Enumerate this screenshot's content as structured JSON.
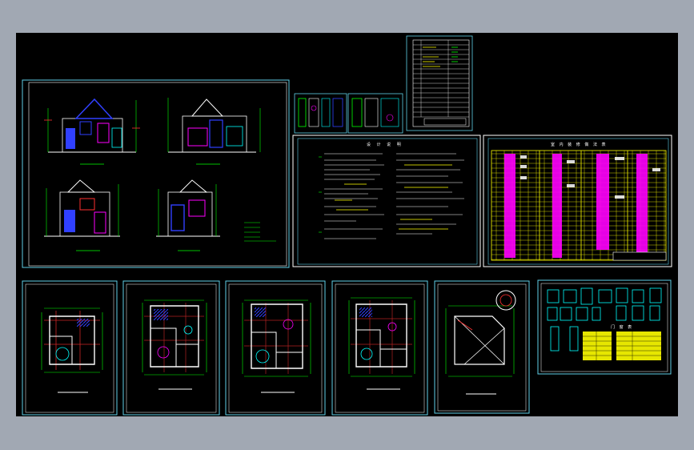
{
  "app": {
    "viewport_background": "#a1a8b3",
    "model_space_background": "#000000"
  },
  "sheets": {
    "elevations": {
      "name": "elevation-sheet"
    },
    "detail_small_a": {
      "name": "detail-sheet-a"
    },
    "detail_small_b": {
      "name": "detail-sheet-b"
    },
    "drawing_index": {
      "name": "drawing-index-sheet"
    },
    "design_notes": {
      "name": "design-notes-sheet",
      "title": "设 计 说 明"
    },
    "door_window_table": {
      "name": "door-window-schedule-sheet",
      "title": "室 内 装 修 做 法 表"
    },
    "plan_1": {
      "name": "floor-plan-1-sheet"
    },
    "plan_2": {
      "name": "floor-plan-2-sheet"
    },
    "plan_3": {
      "name": "floor-plan-3-sheet"
    },
    "plan_4": {
      "name": "floor-plan-4-sheet"
    },
    "roof_plan": {
      "name": "roof-plan-sheet"
    },
    "door_window_details": {
      "name": "door-window-detail-sheet",
      "title": "门 窗 表"
    }
  },
  "colors": {
    "sheet_border": "#5fd0e8",
    "wall": "#ffffff",
    "dimension": "#00ff00",
    "text_yellow": "#ffff00",
    "text_magenta": "#ff00ff",
    "accent_blue": "#3040ff",
    "accent_red": "#ff3030",
    "accent_cyan": "#00ffff"
  }
}
